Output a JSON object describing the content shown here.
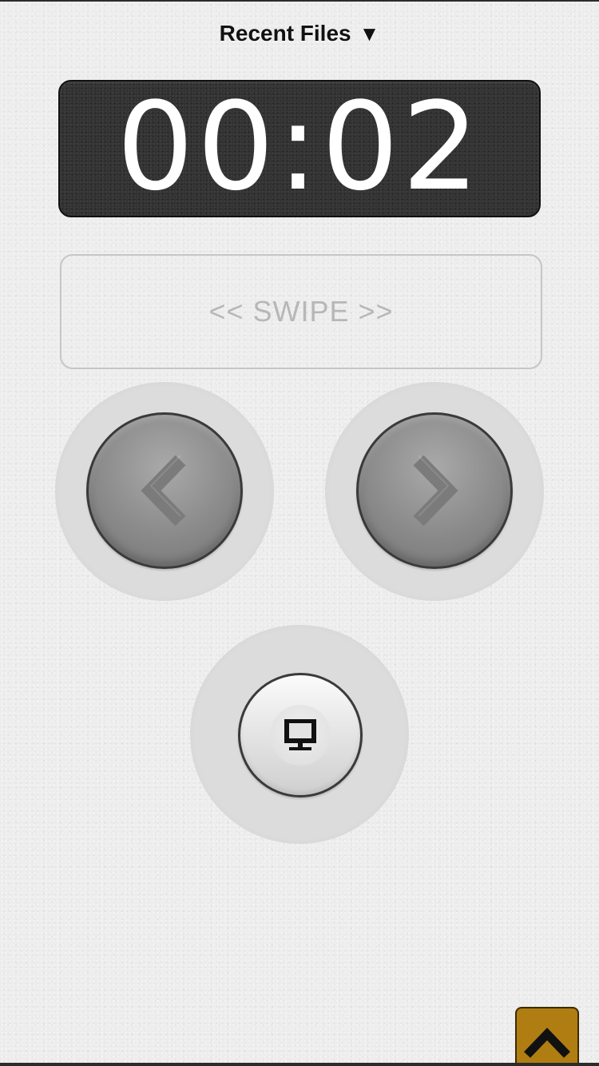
{
  "header": {
    "recent_files_label": "Recent Files",
    "dropdown_arrow": "▼"
  },
  "timer": {
    "display": "00:02"
  },
  "swipe": {
    "label": "<< SWIPE >>"
  },
  "controls": {
    "previous_icon": "chevron-left-icon",
    "next_icon": "chevron-right-icon",
    "present_icon": "monitor-icon",
    "toggle_icon": "chevron-up-icon"
  },
  "colors": {
    "background": "#ededed",
    "timer_background": "#333333",
    "timer_text": "#ffffff",
    "swipe_text": "#b7b7b7",
    "nav_button": "#8a8a8a",
    "toggle_button": "#b07d12"
  }
}
